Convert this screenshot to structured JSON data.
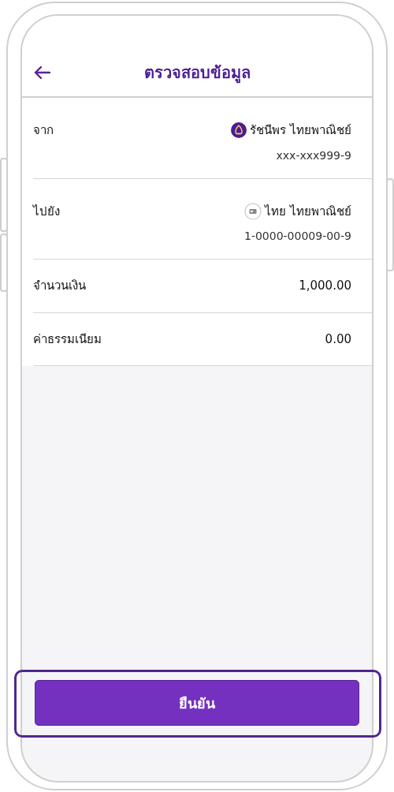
{
  "header": {
    "title": "ตรวจสอบข้อมูล"
  },
  "rows": [
    {
      "kind": "party",
      "label": "จาก",
      "name": "รัชนีพร ไทยพาณิชย์",
      "account": "xxx-xxx999-9"
    },
    {
      "kind": "party",
      "label": "ไปยัง",
      "name": "ไทย ไทยพาณิชย์",
      "account": "1-0000-00009-00-9"
    },
    {
      "kind": "value",
      "label": "จำนวนเงิน",
      "value": "1,000.00"
    },
    {
      "kind": "value",
      "label": "ค่าธรรมเนียม",
      "value": "0.00"
    }
  ],
  "confirm_button": {
    "label": "ยืนยัน",
    "highlighted": true
  }
}
